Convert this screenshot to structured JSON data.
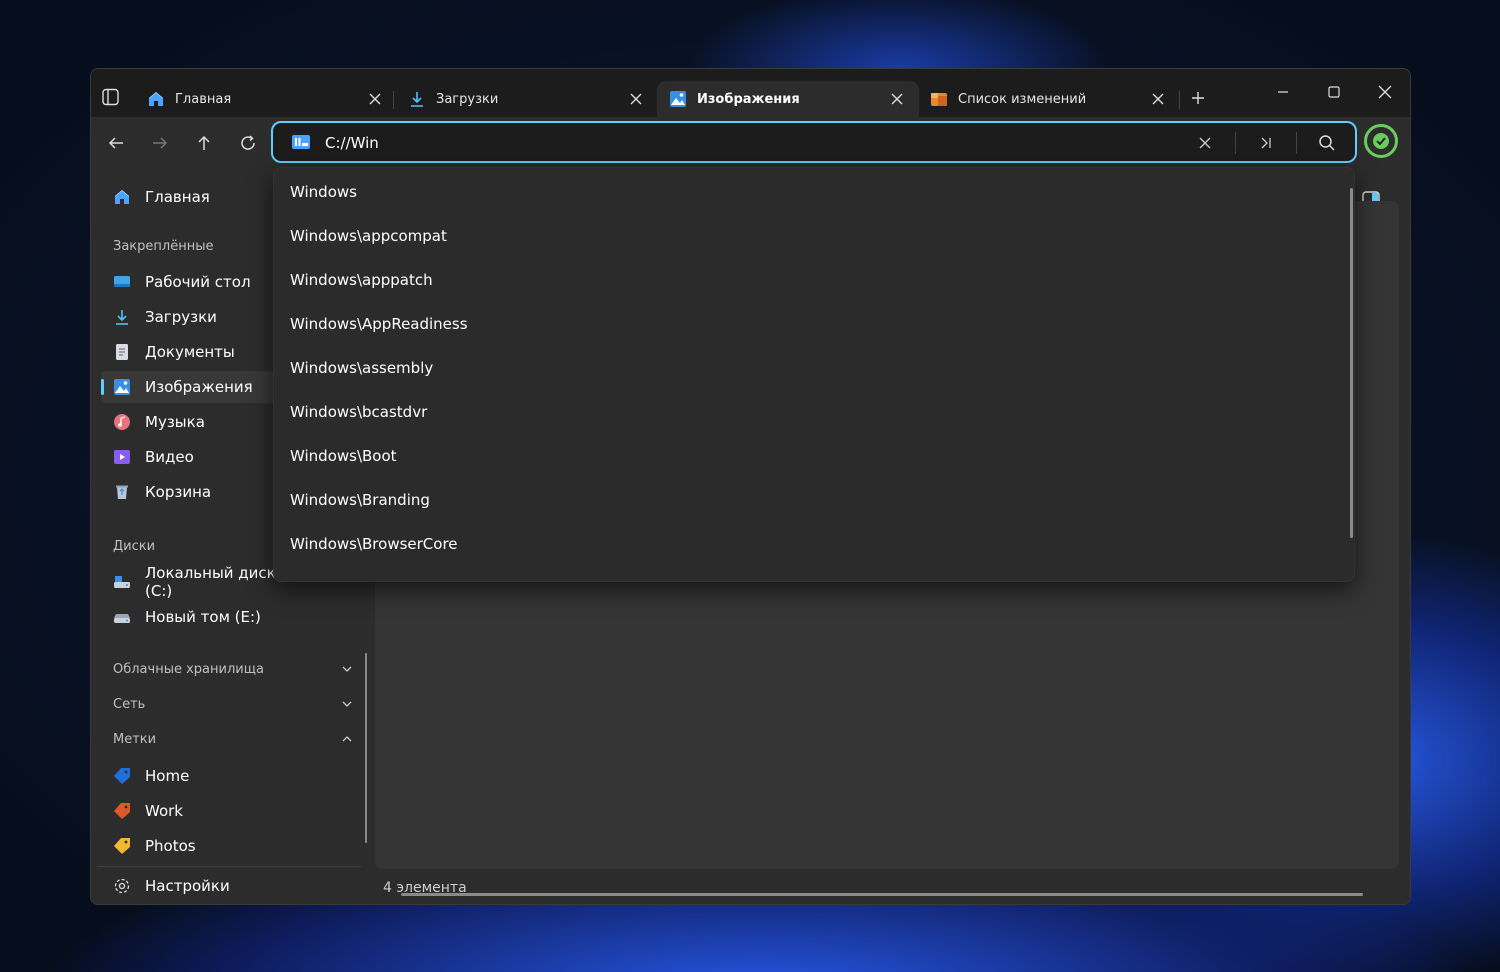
{
  "tabs": [
    {
      "label": "Главная",
      "icon": "home-icon"
    },
    {
      "label": "Загрузки",
      "icon": "download-icon"
    },
    {
      "label": "Изображения",
      "icon": "pictures-icon",
      "active": true
    },
    {
      "label": "Список изменений",
      "icon": "changelog-icon"
    }
  ],
  "address": {
    "value": "C://Win"
  },
  "suggestions": [
    "Windows",
    "Windows\\appcompat",
    "Windows\\apppatch",
    "Windows\\AppReadiness",
    "Windows\\assembly",
    "Windows\\bcastdvr",
    "Windows\\Boot",
    "Windows\\Branding",
    "Windows\\BrowserCore"
  ],
  "sidebar": {
    "home": "Главная",
    "pinned_header": "Закреплённые",
    "pinned": [
      "Рабочий стол",
      "Загрузки",
      "Документы",
      "Изображения",
      "Музыка",
      "Видео",
      "Корзина"
    ],
    "drives_header": "Диски",
    "drives": [
      "Локальный диск (C:)",
      "Новый том (E:)"
    ],
    "cloud_header": "Облачные хранилища",
    "network_header": "Сеть",
    "tags_header": "Метки",
    "tags": [
      "Home",
      "Work",
      "Photos"
    ],
    "settings": "Настройки"
  },
  "status": {
    "items": "4 элемента"
  },
  "colors": {
    "accent": "#60cdff",
    "status_ok": "#6ccb5f",
    "tag_home": "#1e6fd9",
    "tag_work": "#e0572a",
    "tag_photos": "#f2b630"
  }
}
